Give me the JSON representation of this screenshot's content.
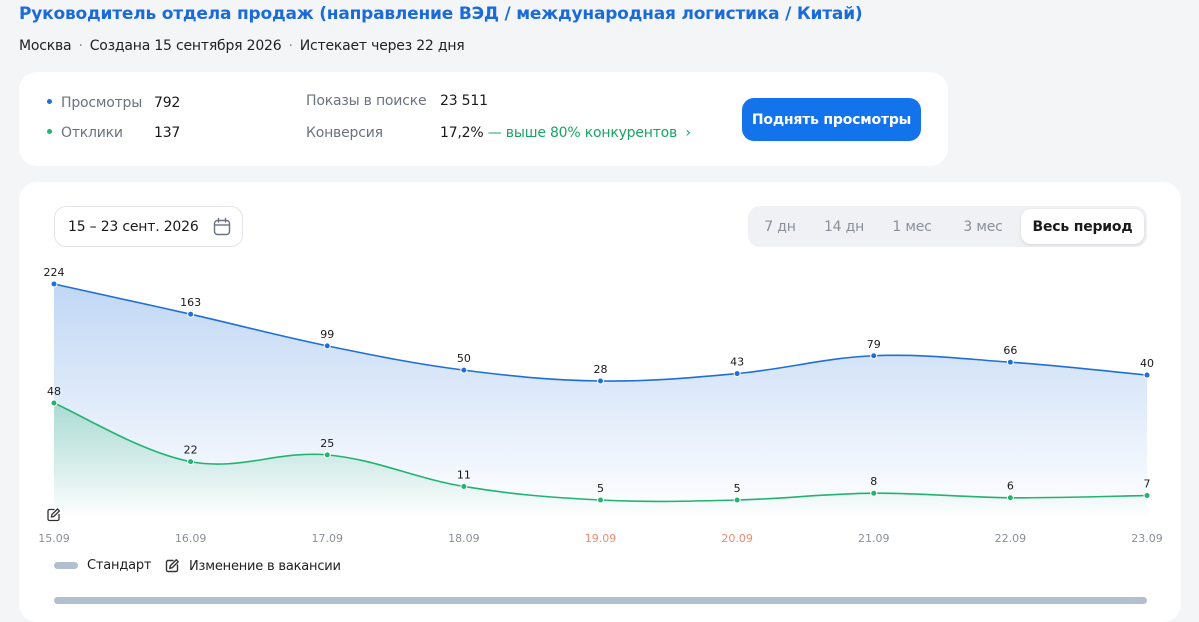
{
  "header": {
    "title": "Руководитель отдела продаж (направление ВЭД / международная логистика / Китай)",
    "city": "Москва",
    "created": "Создана 15 сентября 2026",
    "expires": "Истекает через 22 дня"
  },
  "stats": {
    "views_label": "Просмотры",
    "views_value": "792",
    "responses_label": "Отклики",
    "responses_value": "137",
    "impressions_label": "Показы в поиске",
    "impressions_value": "23 511",
    "conversion_label": "Конверсия",
    "conversion_value": "17,2%",
    "conversion_note": "— выше 80% конкурентов"
  },
  "cta_label": "Поднять просмотры",
  "date_range": "15 – 23 сент. 2026",
  "periods": [
    "7 дн",
    "14 дн",
    "1 мес",
    "3 мес",
    "Весь период"
  ],
  "active_period": "Весь период",
  "legend": {
    "standard": "Стандарт",
    "change": "Изменение в вакансии"
  },
  "colors": {
    "views": "#1f6fd8",
    "responses": "#22b371",
    "weekend": "#f08a73",
    "weekday_axis": "#8a9099",
    "accent": "#1273eb"
  },
  "chart_data": {
    "type": "line",
    "x": [
      "15.09",
      "16.09",
      "17.09",
      "18.09",
      "19.09",
      "20.09",
      "21.09",
      "22.09",
      "23.09"
    ],
    "weekend_labels": [
      "19.09",
      "20.09"
    ],
    "series": [
      {
        "name": "Просмотры",
        "values": [
          224,
          163,
          99,
          50,
          28,
          43,
          79,
          66,
          40
        ]
      },
      {
        "name": "Отклики",
        "values": [
          48,
          22,
          25,
          11,
          5,
          5,
          8,
          6,
          7
        ]
      }
    ],
    "annotations": [
      {
        "x": "15.09",
        "icon": "edit-icon"
      }
    ],
    "grid": false
  }
}
